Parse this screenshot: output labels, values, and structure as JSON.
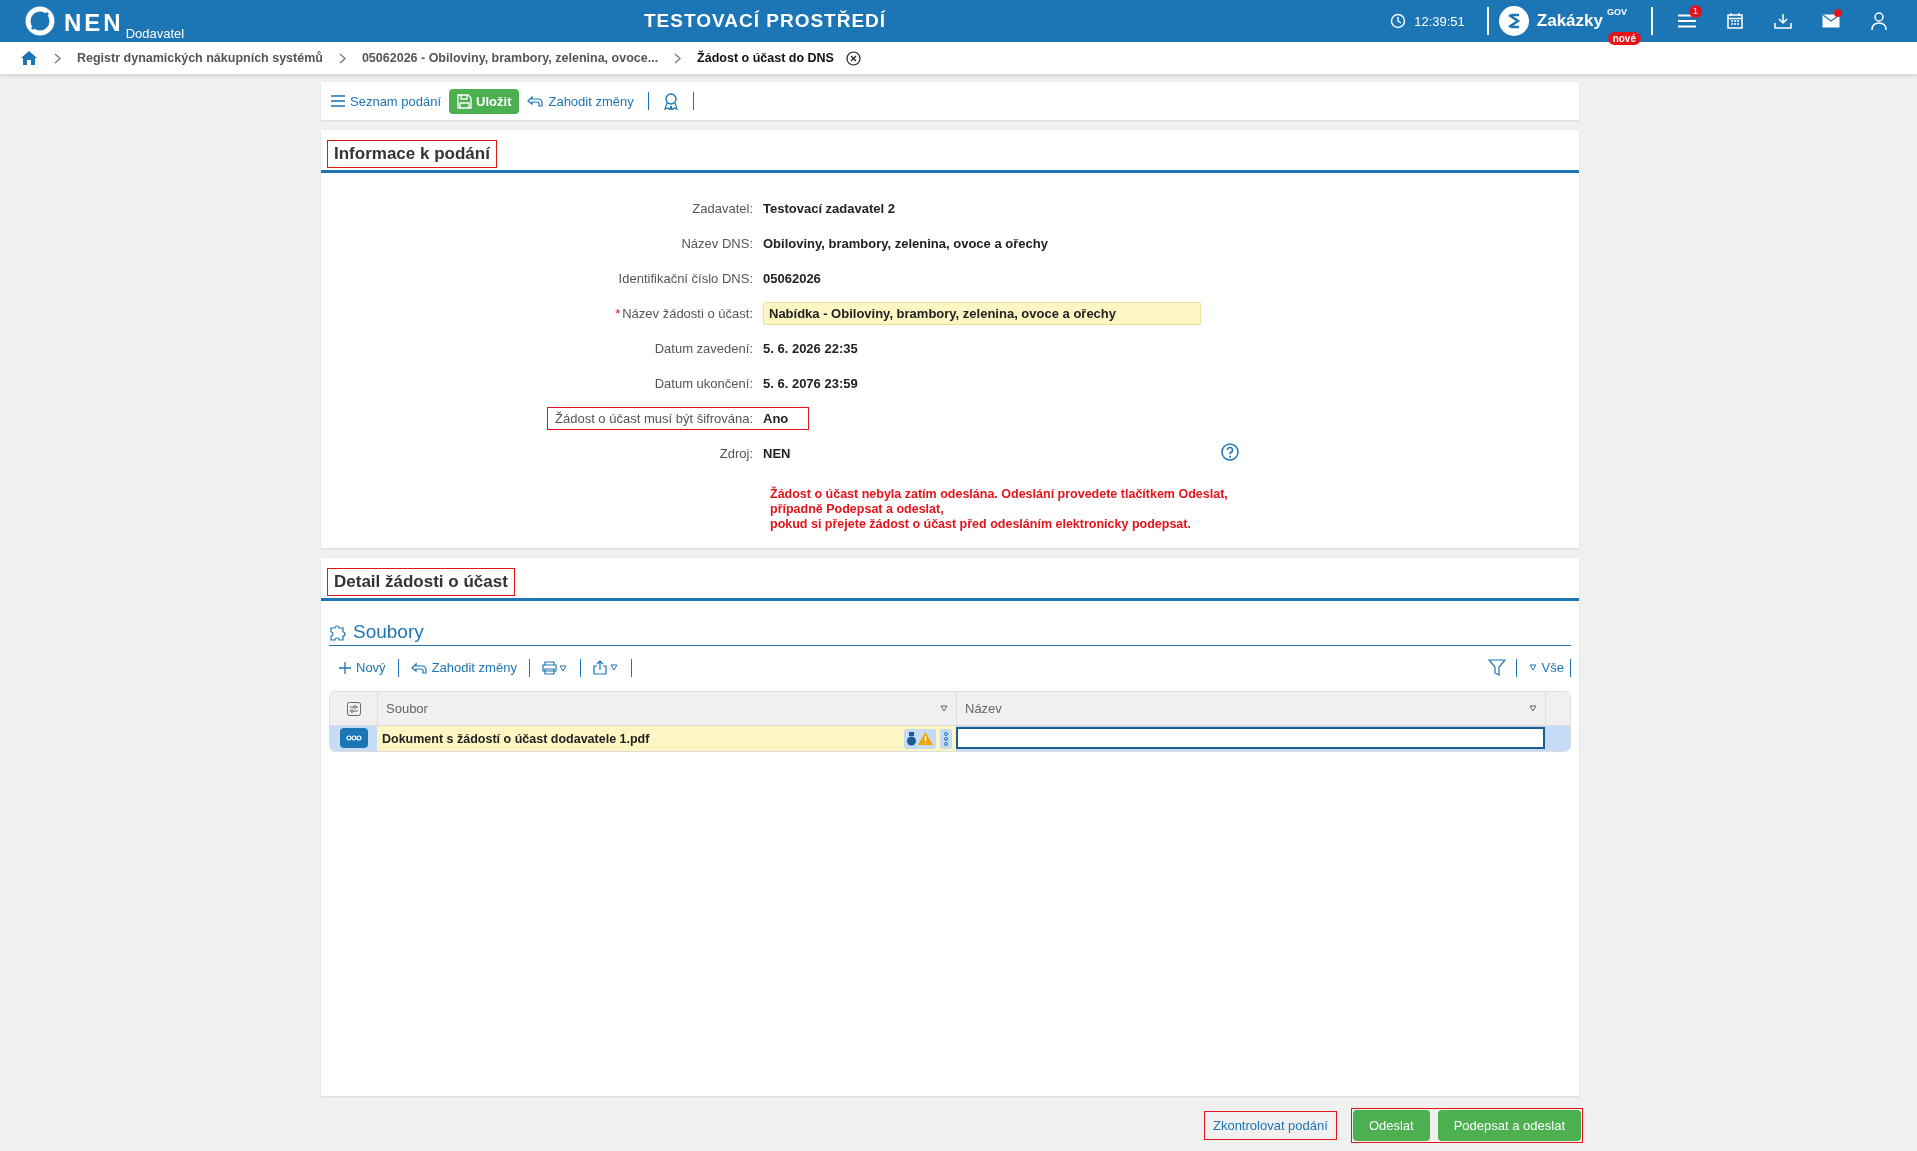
{
  "header": {
    "logo_text": "NEN",
    "logo_sub": "Dodavatel",
    "environment": "TESTOVACÍ PROSTŘEDÍ",
    "time": "12:39:51",
    "brand": "Zakázky",
    "brand_sup": "GOV",
    "brand_badge": "nové",
    "menu_badge": "1",
    "mail_unread": true
  },
  "breadcrumb": [
    {
      "label": "Registr dynamických nákupních systémů",
      "current": false
    },
    {
      "label": "05062026 - Obiloviny, brambory, zelenina, ovoce...",
      "current": false
    },
    {
      "label": "Žádost o účast do DNS",
      "current": true
    }
  ],
  "toolbar": [
    {
      "kind": "list",
      "label": "Seznam podání"
    },
    {
      "kind": "save",
      "label": "Uložit"
    },
    {
      "kind": "discard",
      "label": "Zahodit změny"
    },
    {
      "kind": "award"
    }
  ],
  "info": {
    "title": "Informace k podání",
    "highlighted": true,
    "required_mark": "*",
    "fields": [
      {
        "kind": "text",
        "label": "Zadavatel:",
        "value": "Testovací zadavatel 2",
        "required": false,
        "highlighted": false,
        "help": false
      },
      {
        "kind": "text",
        "label": "Název DNS:",
        "value": "Obiloviny, brambory, zelenina, ovoce a ořechy",
        "required": false,
        "highlighted": false,
        "help": false
      },
      {
        "kind": "text",
        "label": "Identifikační číslo DNS:",
        "value": "05062026",
        "required": false,
        "highlighted": false,
        "help": false
      },
      {
        "kind": "input",
        "label": "Název žádosti o účast:",
        "value": "Nabídka - Obiloviny, brambory, zelenina, ovoce a ořechy",
        "required": true,
        "highlighted": false,
        "help": false
      },
      {
        "kind": "text",
        "label": "Datum zavedení:",
        "value": "5. 6. 2026 22:35",
        "required": false,
        "highlighted": false,
        "help": false
      },
      {
        "kind": "text",
        "label": "Datum ukončení:",
        "value": "5. 6. 2076 23:59",
        "required": false,
        "highlighted": false,
        "help": false
      },
      {
        "kind": "text",
        "label": "Žádost o účast musí být šifrována:",
        "value": "Ano",
        "required": false,
        "highlighted": true,
        "help": false
      },
      {
        "kind": "text",
        "label": "Zdroj:",
        "value": "NEN",
        "required": false,
        "highlighted": false,
        "help": true
      }
    ],
    "warning": [
      "Žádost o účast nebyla zatím odeslána. Odeslání provedete tlačítkem Odeslat,",
      "případně Podepsat a odeslat,",
      "pokud si přejete žádost o účast před odesláním elektronicky podepsat."
    ]
  },
  "detail": {
    "title": "Detail žádosti o účast",
    "highlighted": true,
    "files": {
      "title": "Soubory",
      "new": "Nový",
      "discard": "Zahodit změny",
      "filter": "Vše",
      "columns": [
        "Soubor",
        "Název"
      ],
      "rows": [
        {
          "file": "Dokument s žádostí o účast dodavatele 1.pdf",
          "selected": true
        }
      ]
    }
  },
  "footer": {
    "check": {
      "label": "Zkontrolovat podání",
      "highlighted": true
    },
    "actions": {
      "highlighted": true,
      "buttons": [
        "Odeslat",
        "Podepsat a odeslat"
      ]
    }
  }
}
